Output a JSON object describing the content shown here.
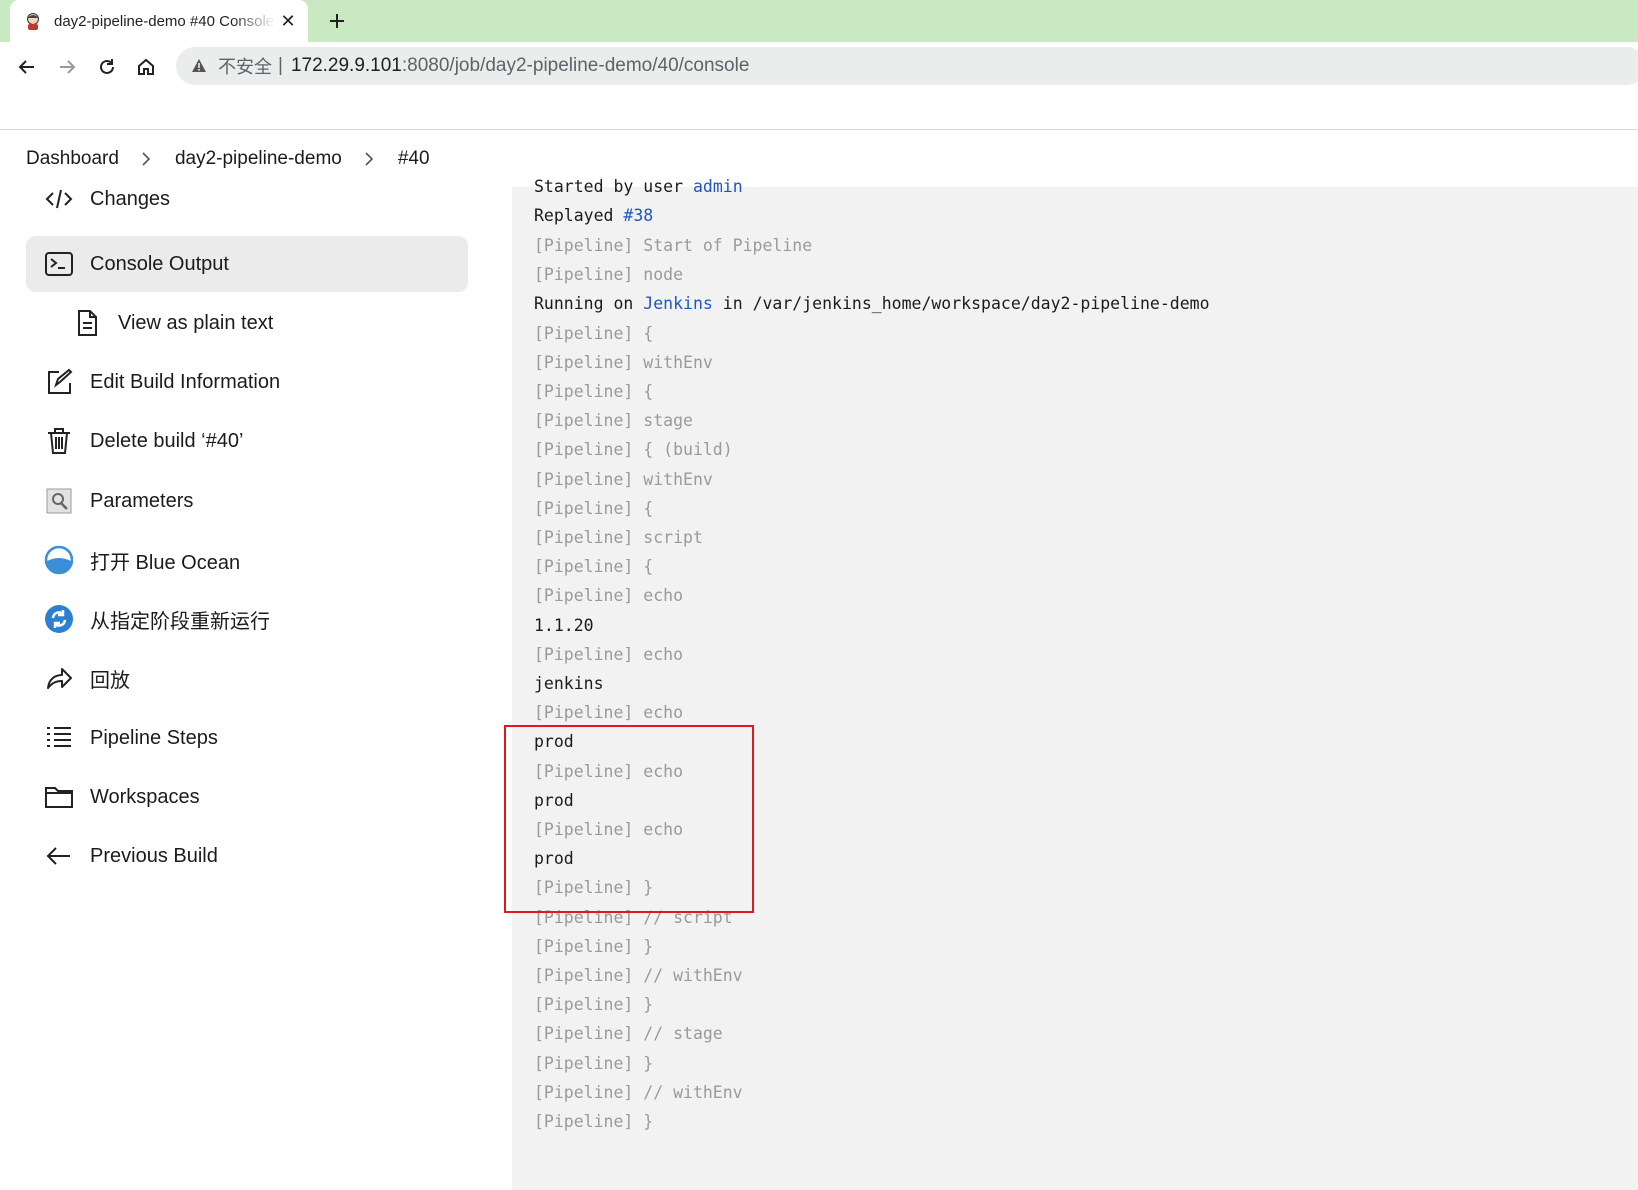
{
  "browser": {
    "tab_title": "day2-pipeline-demo #40 Console",
    "tab_close": "✕",
    "new_tab": "+",
    "insecure_label": "不安全",
    "separator": "|",
    "url_host": "172.29.9.101",
    "url_rest": ":8080/job/day2-pipeline-demo/40/console"
  },
  "breadcrumb": {
    "items": [
      "Dashboard",
      "day2-pipeline-demo",
      "#40"
    ]
  },
  "sidebar": {
    "items": [
      {
        "label": "Changes",
        "icon": "code-icon"
      },
      {
        "label": "Console Output",
        "icon": "terminal-icon"
      },
      {
        "label": "View as plain text",
        "icon": "document-icon"
      },
      {
        "label": "Edit Build Information",
        "icon": "edit-icon"
      },
      {
        "label": "Delete build ‘#40’",
        "icon": "trash-icon"
      },
      {
        "label": "Parameters",
        "icon": "parameters-icon"
      },
      {
        "label": "打开 Blue Ocean",
        "icon": "blue-ocean-icon"
      },
      {
        "label": "从指定阶段重新运行",
        "icon": "restart-icon"
      },
      {
        "label": "回放",
        "icon": "replay-icon"
      },
      {
        "label": "Pipeline Steps",
        "icon": "list-icon"
      },
      {
        "label": "Workspaces",
        "icon": "folder-icon"
      },
      {
        "label": "Previous Build",
        "icon": "arrow-left-icon"
      }
    ]
  },
  "console": {
    "started_by": "Started by user ",
    "user_link": "admin",
    "replayed": "Replayed ",
    "replay_link": "#38",
    "running_prefix": "Running on ",
    "node_link": "Jenkins",
    "running_suffix": " in /var/jenkins_home/workspace/day2-pipeline-demo",
    "lines": [
      {
        "text": "[Pipeline] Start of Pipeline",
        "muted": true
      },
      {
        "text": "[Pipeline] node",
        "muted": true
      },
      {
        "text": "[Pipeline] {",
        "muted": true
      },
      {
        "text": "[Pipeline] withEnv",
        "muted": true
      },
      {
        "text": "[Pipeline] {",
        "muted": true
      },
      {
        "text": "[Pipeline] stage",
        "muted": true
      },
      {
        "text": "[Pipeline] { (build)",
        "muted": true
      },
      {
        "text": "[Pipeline] withEnv",
        "muted": true
      },
      {
        "text": "[Pipeline] {",
        "muted": true
      },
      {
        "text": "[Pipeline] script",
        "muted": true
      },
      {
        "text": "[Pipeline] {",
        "muted": true
      },
      {
        "text": "[Pipeline] echo",
        "muted": true
      },
      {
        "text": "1.1.20",
        "muted": false
      },
      {
        "text": "[Pipeline] echo",
        "muted": true
      },
      {
        "text": "jenkins",
        "muted": false
      },
      {
        "text": "[Pipeline] echo",
        "muted": true
      },
      {
        "text": "prod",
        "muted": false
      },
      {
        "text": "[Pipeline] echo",
        "muted": true
      },
      {
        "text": "prod",
        "muted": false
      },
      {
        "text": "[Pipeline] echo",
        "muted": true
      },
      {
        "text": "prod",
        "muted": false
      },
      {
        "text": "[Pipeline] }",
        "muted": true
      },
      {
        "text": "[Pipeline] // script",
        "muted": true
      },
      {
        "text": "[Pipeline] }",
        "muted": true
      },
      {
        "text": "[Pipeline] // withEnv",
        "muted": true
      },
      {
        "text": "[Pipeline] }",
        "muted": true
      },
      {
        "text": "[Pipeline] // stage",
        "muted": true
      },
      {
        "text": "[Pipeline] }",
        "muted": true
      },
      {
        "text": "[Pipeline] // withEnv",
        "muted": true
      },
      {
        "text": "[Pipeline] }",
        "muted": true
      }
    ]
  },
  "colors": {
    "tabstrip": "#c9e9c2",
    "link": "#1f55c4",
    "muted_text": "#9a9a9a",
    "highlight_border": "#e0191f",
    "console_bg": "#f2f2f2"
  }
}
